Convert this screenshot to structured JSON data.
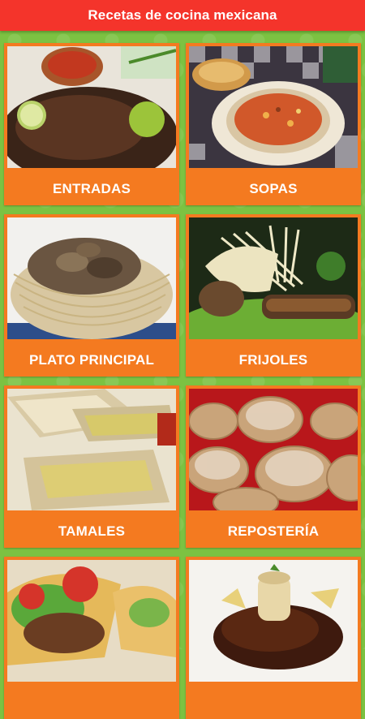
{
  "app": {
    "title": "Recetas de cocina mexicana"
  },
  "categories": [
    {
      "label": "ENTRADAS",
      "image": "dish-entradas-photo"
    },
    {
      "label": "SOPAS",
      "image": "dish-sopas-photo"
    },
    {
      "label": "PLATO PRINCIPAL",
      "image": "dish-plato-principal-photo"
    },
    {
      "label": "FRIJOLES",
      "image": "dish-frijoles-photo"
    },
    {
      "label": "TAMALES",
      "image": "dish-tamales-photo"
    },
    {
      "label": "REPOSTERÍA",
      "image": "dish-reposteria-photo"
    },
    {
      "label": "",
      "image": "dish-tacos-photo"
    },
    {
      "label": "",
      "image": "dish-mole-photo"
    }
  ],
  "colors": {
    "appbar": "#f4342b",
    "card": "#f47a20",
    "background": "#7cc242"
  }
}
